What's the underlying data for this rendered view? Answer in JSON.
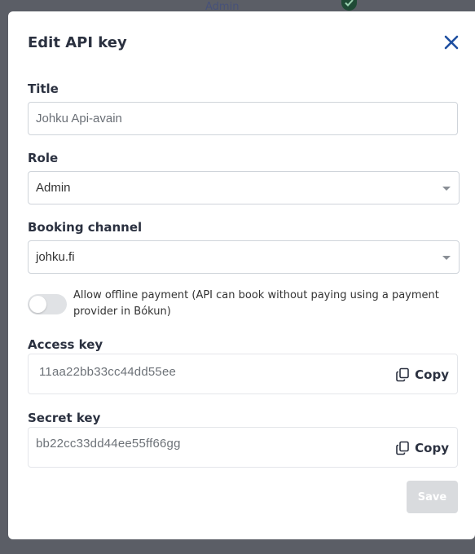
{
  "background": {
    "role_label": "Admin"
  },
  "modal": {
    "title": "Edit API key",
    "title_field": {
      "label": "Title",
      "value": "Johku Api-avain"
    },
    "role_field": {
      "label": "Role",
      "selected": "Admin"
    },
    "booking_channel_field": {
      "label": "Booking channel",
      "selected": "johku.fi"
    },
    "offline_payment": {
      "enabled": false,
      "label": "Allow offline payment (API can book without paying using a payment provider in Bókun)"
    },
    "access_key": {
      "label": "Access key",
      "value": "11aa22bb33cc44dd55ee",
      "copy_label": "Copy"
    },
    "secret_key": {
      "label": "Secret key",
      "value": "bb22cc33dd44ee55ff66gg",
      "copy_label": "Copy"
    },
    "save_label": "Save"
  },
  "colors": {
    "accent": "#1e4fa0",
    "overlay": "#5b5e66",
    "save_disabled": "#d9dbde"
  },
  "icons": {
    "close": "close-icon",
    "copy": "copy-icon",
    "check": "check-icon",
    "caret": "chevron-down-icon"
  }
}
